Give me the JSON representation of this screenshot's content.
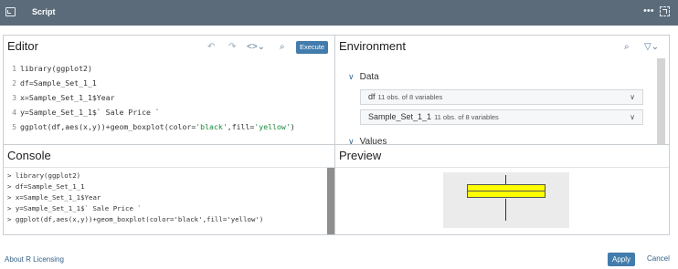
{
  "window": {
    "title": "Script",
    "more_icon": "more-icon",
    "expand_icon": "expand-icon"
  },
  "editor": {
    "title": "Editor",
    "execute_label": "Execute",
    "lines": [
      {
        "n": "1",
        "text": "library(ggplot2)"
      },
      {
        "n": "2",
        "text": "df=Sample_Set_1_1"
      },
      {
        "n": "3",
        "text": "x=Sample_Set_1_1$Year"
      },
      {
        "n": "4",
        "text": "y=Sample_Set_1_1$` Sale Price `"
      },
      {
        "n": "5",
        "pre": "ggplot(df,aes(x,y))+geom_boxplot(color=",
        "s1": "'black'",
        "mid": ",fill=",
        "s2": "'yellow'",
        "post": ")"
      }
    ]
  },
  "environment": {
    "title": "Environment",
    "data_label": "Data",
    "values_label": "Values",
    "datasets": [
      {
        "name": "df",
        "info": "11 obs. of 8 variables"
      },
      {
        "name": "Sample_Set_1_1",
        "info": "11 obs. of 8 variables"
      }
    ]
  },
  "console": {
    "title": "Console",
    "lines": [
      "> library(ggplot2)",
      "> df=Sample_Set_1_1",
      "> x=Sample_Set_1_1$Year",
      "> y=Sample_Set_1_1$` Sale Price `",
      "> ggplot(df,aes(x,y))+geom_boxplot(color='black',fill='yellow')"
    ]
  },
  "preview": {
    "title": "Preview",
    "box_fill": "#ffff00",
    "box_outline": "#000000"
  },
  "footer": {
    "link": "About R Licensing",
    "apply": "Apply",
    "cancel": "Cancel"
  },
  "colors": {
    "titlebar": "#5b6b7a",
    "accent": "#427cac",
    "link": "#346187"
  }
}
